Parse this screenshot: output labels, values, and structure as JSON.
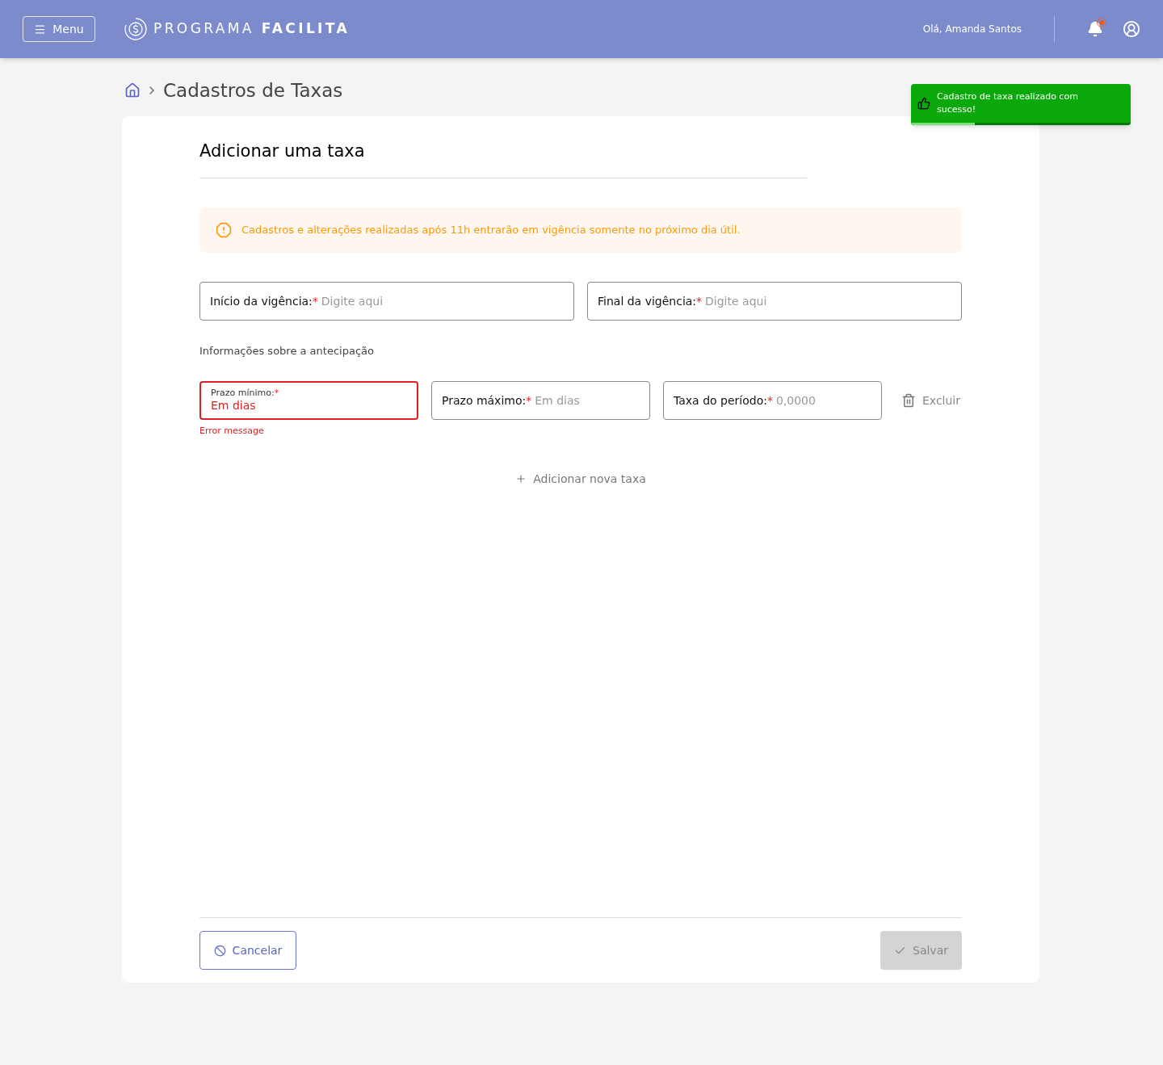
{
  "header": {
    "menu_button": "Menu",
    "logo": "PROGRAMA **FACILITA**",
    "greeting": "Olá, Amanda Santos",
    "notifications": {
      "unread": true
    }
  },
  "breadcrumb": {
    "title": "Cadastros de Taxas"
  },
  "toast": {
    "message": "Cadastro de taxa realizado com sucesso!",
    "level": 0.29
  },
  "form": {
    "title": "Adicionar uma taxa",
    "warning": "Cadastros e alterações realizadas após 11h entrarão em vigência somente no próximo dia útil.",
    "period_fields": [
      {
        "label": "Início da vigência:",
        "required_mark": "*",
        "placeholder": "Digite aqui",
        "error": false
      },
      {
        "label": "Final da vigência:",
        "required_mark": "*",
        "placeholder": "Digite aqui",
        "error": false
      }
    ],
    "section_title": "Informações sobre a antecipação",
    "rate_fields": [
      {
        "label": "Prazo mínimo:",
        "required_mark": "*",
        "placeholder": "Em dias",
        "error": true,
        "error_message": "Error message"
      },
      {
        "label": "Prazo máximo:",
        "required_mark": "*",
        "placeholder": "Em dias",
        "error": false
      },
      {
        "label": "Taxa do período:",
        "required_mark": "*",
        "placeholder": "0,0000",
        "error": false
      }
    ],
    "delete_button": "Excluir",
    "add_button": "Adicionar nova taxa",
    "cancel_button": "Cancelar",
    "save_button": {
      "label": "Salvar",
      "disabled": true
    }
  }
}
